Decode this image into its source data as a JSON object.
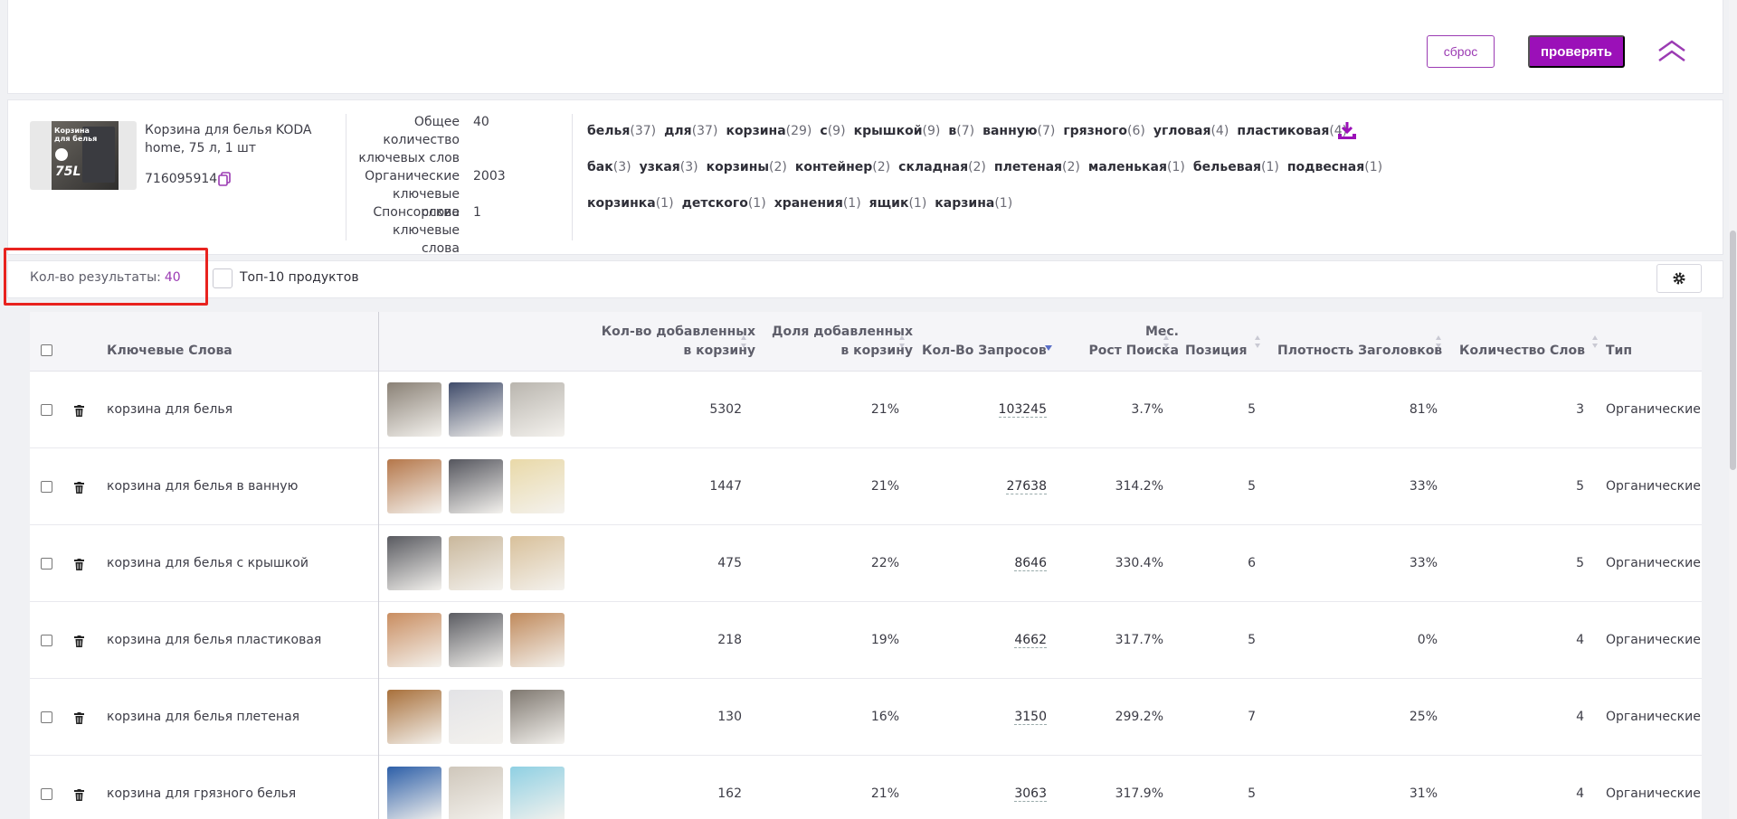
{
  "top": {
    "reset_label": "сброс",
    "check_label": "проверять"
  },
  "product": {
    "title": "Корзина для белья KODA home, 75 л, 1 шт",
    "id": "716095914",
    "thumb_text": "Корзина для белья",
    "thumb_badge": "75L",
    "stats": [
      {
        "label": "Общее количество ключевых слов",
        "value": "40"
      },
      {
        "label": "Органические ключевые слова",
        "value": "2003"
      },
      {
        "label": "Спонсорские ключевые слова",
        "value": "1"
      }
    ],
    "tag_lines": [
      [
        {
          "word": "белья",
          "count": "(37)"
        },
        {
          "word": "для",
          "count": "(37)"
        },
        {
          "word": "корзина",
          "count": "(29)"
        },
        {
          "word": "с",
          "count": "(9)"
        },
        {
          "word": "крышкой",
          "count": "(9)"
        },
        {
          "word": "в",
          "count": "(7)"
        },
        {
          "word": "ванную",
          "count": "(7)"
        },
        {
          "word": "грязного",
          "count": "(6)"
        },
        {
          "word": "угловая",
          "count": "(4)"
        },
        {
          "word": "пластиковая",
          "count": "(4)"
        }
      ],
      [
        {
          "word": "бак",
          "count": "(3)"
        },
        {
          "word": "узкая",
          "count": "(3)"
        },
        {
          "word": "корзины",
          "count": "(2)"
        },
        {
          "word": "контейнер",
          "count": "(2)"
        },
        {
          "word": "складная",
          "count": "(2)"
        },
        {
          "word": "плетеная",
          "count": "(2)"
        },
        {
          "word": "маленькая",
          "count": "(1)"
        },
        {
          "word": "бельевая",
          "count": "(1)"
        },
        {
          "word": "подвесная",
          "count": "(1)"
        }
      ],
      [
        {
          "word": "корзинка",
          "count": "(1)"
        },
        {
          "word": "детского",
          "count": "(1)"
        },
        {
          "word": "хранения",
          "count": "(1)"
        },
        {
          "word": "ящик",
          "count": "(1)"
        },
        {
          "word": "карзина",
          "count": "(1)"
        }
      ]
    ]
  },
  "results": {
    "label": "Кол-во результаты:",
    "count": "40",
    "top10_label": "Топ-10 продуктов"
  },
  "table": {
    "headers": {
      "keywords": "Ключевые Слова",
      "added_1": "Кол-во добавленных",
      "added_2": "в корзину",
      "share_1": "Доля добавленных",
      "share_2": "в корзину",
      "queries": "Кол-Во Запросов",
      "growth_1": "Мес.",
      "growth_2": "Рост Поиска",
      "position": "Позиция",
      "density": "Плотность Заголовков",
      "word_count": "Количество Слов",
      "type": "Тип"
    },
    "rows": [
      {
        "keyword": "корзина для белья",
        "added": "5302",
        "share": "21%",
        "queries": "103245",
        "growth": "3.7%",
        "position": "5",
        "density": "81%",
        "words": "3",
        "type": "Органические к",
        "thumbs": [
          "#8a8176",
          "#3f4b6a",
          "#b9b5ae"
        ]
      },
      {
        "keyword": "корзина для белья в ванную",
        "added": "1447",
        "share": "21%",
        "queries": "27638",
        "growth": "314.2%",
        "position": "5",
        "density": "33%",
        "words": "5",
        "type": "Органические к",
        "thumbs": [
          "#b5774a",
          "#55565e",
          "#e9d9a8"
        ]
      },
      {
        "keyword": "корзина для белья с крышкой",
        "added": "475",
        "share": "22%",
        "queries": "8646",
        "growth": "330.4%",
        "position": "6",
        "density": "33%",
        "words": "5",
        "type": "Органические к",
        "thumbs": [
          "#595a60",
          "#c9b79b",
          "#d8c09a"
        ]
      },
      {
        "keyword": "корзина для белья пластиковая",
        "added": "218",
        "share": "19%",
        "queries": "4662",
        "growth": "317.7%",
        "position": "5",
        "density": "0%",
        "words": "4",
        "type": "Органические к",
        "thumbs": [
          "#c98d60",
          "#5b5c62",
          "#c08a5c"
        ]
      },
      {
        "keyword": "корзина для белья плетеная",
        "added": "130",
        "share": "16%",
        "queries": "3150",
        "growth": "299.2%",
        "position": "7",
        "density": "25%",
        "words": "4",
        "type": "Органические к",
        "thumbs": [
          "#a8703b",
          "#e3e3e6",
          "#7f7870"
        ]
      },
      {
        "keyword": "корзина для грязного белья",
        "added": "162",
        "share": "21%",
        "queries": "3063",
        "growth": "317.9%",
        "position": "5",
        "density": "31%",
        "words": "4",
        "type": "Органические к",
        "thumbs": [
          "#2d5fa8",
          "#cfc7bb",
          "#8fd0e3"
        ]
      }
    ]
  },
  "colors": {
    "accent": "#9b10b8",
    "highlight": "#e8231f"
  }
}
